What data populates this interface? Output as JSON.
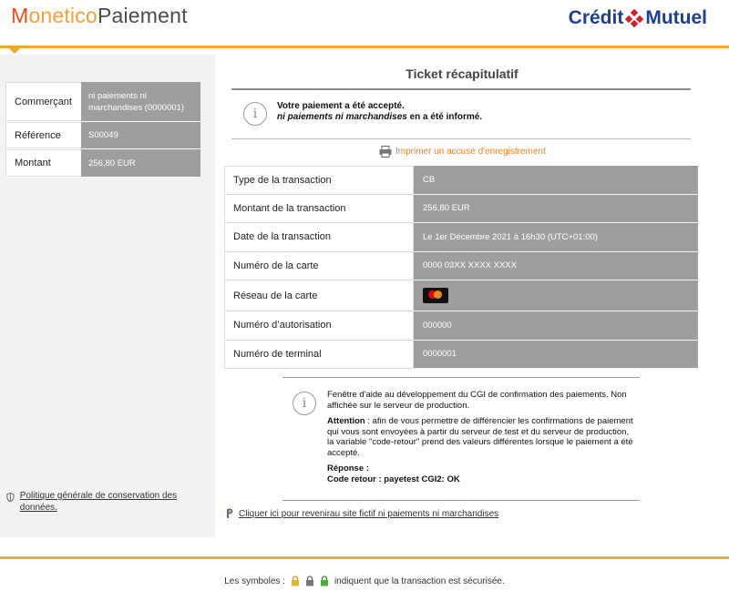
{
  "header": {
    "brand_part1": "M",
    "brand_part2": "onetico",
    "brand_part3": "Paiement",
    "bank_part1": "Crédit",
    "bank_part2": "Mutuel",
    "colors": {
      "orange": "#f4a531",
      "bank_blue": "#1c3e94",
      "bank_red": "#d5202e"
    }
  },
  "merchant": {
    "rows": [
      {
        "label": "Commerçant",
        "value": "ni paiements ni marchandises (0000001)"
      },
      {
        "label": "Référence",
        "value": "S00049"
      },
      {
        "label": "Montant",
        "value": "256,80 EUR"
      }
    ]
  },
  "policy": {
    "label": "Politique générale de conservation des données."
  },
  "ticket": {
    "title": "Ticket récapitulatif",
    "accepted_line1": "Votre paiement a été accepté.",
    "accepted_merchant": "ni paiements ni marchandises",
    "accepted_line2_suffix": " en a été informé.",
    "print_label": "Imprimer un accusé d'enregistrement"
  },
  "transaction": {
    "rows": [
      {
        "label": "Type de la transaction",
        "value": "CB"
      },
      {
        "label": "Montant de la transaction",
        "value": "256,80 EUR"
      },
      {
        "label": "Date de la transaction",
        "value": "Le 1er Décembre 2021 à 16h30 (UTC+01:00)"
      },
      {
        "label": "Numéro de la carte",
        "value": "0000 03XX XXXX XXXX"
      },
      {
        "label": "Réseau de la carte",
        "value": "",
        "icon": "mastercard-icon"
      },
      {
        "label": "Numéro d’autorisation",
        "value": "000000"
      },
      {
        "label": "Numéro de terminal",
        "value": "0000001"
      }
    ]
  },
  "help": {
    "intro": "Fenêtre d'aide au développement du CGI de confirmation des paiements. Non affichée sur le serveur de production.",
    "attention_label": "Attention",
    "attention_text": " :  afin de vous permettre de différencier les confirmations de paiement qui vous sont envoyées à partir du serveur de test et du serveur de production, la variable \"code-retour\" prend des valeurs différentes lorsque le paiement a été accepté.",
    "response_label": "Réponse :",
    "response_code": "Code retour : payetest CGI2: OK"
  },
  "back_link": {
    "label": "Cliquer ici pour revenirau site fictif ni paiements ni marchandises"
  },
  "footer": {
    "prefix": "Les symboles :",
    "suffix": "indiquent que la transaction est sécurisée."
  }
}
